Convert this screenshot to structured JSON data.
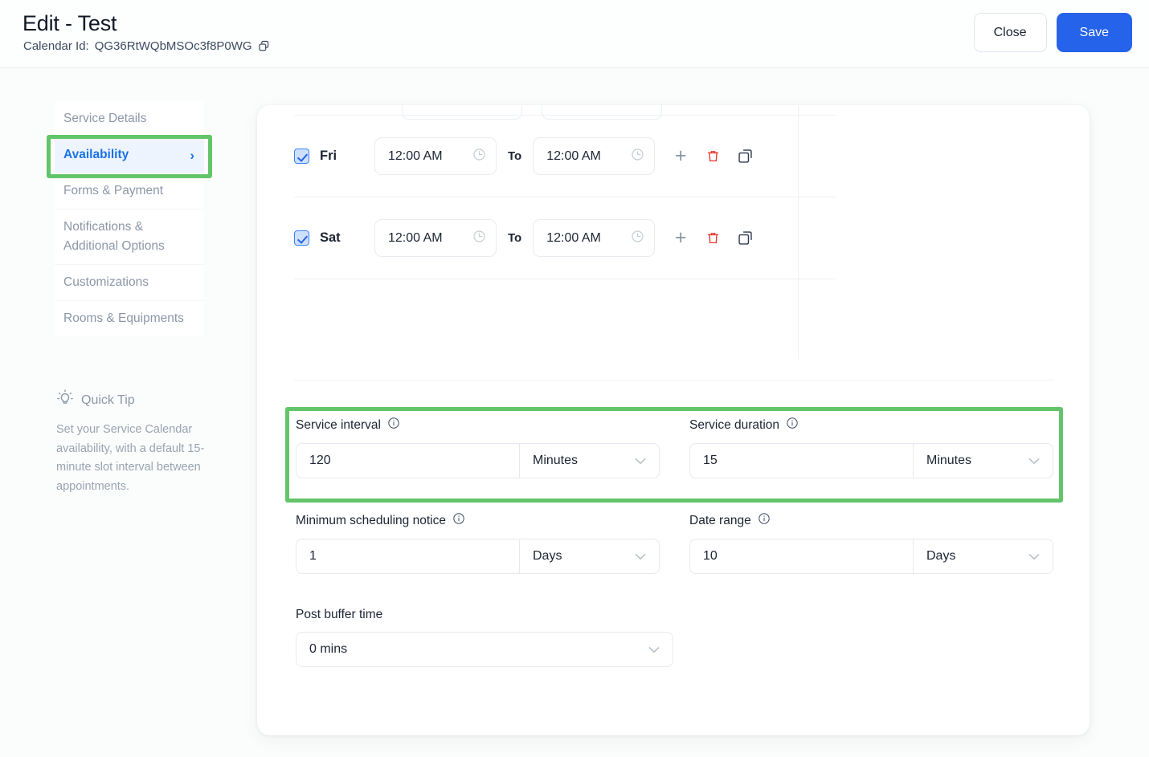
{
  "header": {
    "title": "Edit - Test",
    "calendar_id_label": "Calendar Id:",
    "calendar_id": "QG36RtWQbMSOc3f8P0WG",
    "copy_icon": "copy-icon",
    "close_label": "Close",
    "save_label": "Save",
    "save_color": "#2563eb"
  },
  "sidebar": {
    "items": [
      {
        "label": "Service Details",
        "active": false
      },
      {
        "label": "Availability",
        "active": true,
        "chevron": "›"
      },
      {
        "label": "Forms & Payment",
        "active": false
      },
      {
        "label": "Notifications & Additional Options",
        "active": false
      },
      {
        "label": "Customizations",
        "active": false
      },
      {
        "label": "Rooms & Equipments",
        "active": false
      }
    ],
    "highlight_color": "#63c56a",
    "active_color": "#1a73e8"
  },
  "quick_tip": {
    "icon": "lightbulb-icon",
    "title": "Quick Tip",
    "body": "Set your Service Calendar availability, with a default 15-minute slot interval between appointments."
  },
  "availability": {
    "to_label": "To",
    "days": [
      {
        "name": "Fri",
        "checked": true,
        "start": "12:00 AM",
        "end": "12:00 AM",
        "add_icon": "plus-icon",
        "delete_icon": "trash-icon",
        "duplicate_icon": "duplicate-icon"
      },
      {
        "name": "Sat",
        "checked": true,
        "start": "12:00 AM",
        "end": "12:00 AM",
        "add_icon": "plus-icon",
        "delete_icon": "trash-icon",
        "duplicate_icon": "duplicate-icon"
      }
    ],
    "clock_icon": "clock-icon",
    "delete_color": "#e8342a"
  },
  "settings": {
    "service_interval": {
      "label": "Service interval",
      "info_icon": "info-icon",
      "value": "120",
      "unit": "Minutes",
      "highlighted": true
    },
    "service_duration": {
      "label": "Service duration",
      "info_icon": "info-icon",
      "value": "15",
      "unit": "Minutes",
      "highlighted": true
    },
    "minimum_scheduling_notice": {
      "label": "Minimum scheduling notice",
      "info_icon": "info-icon",
      "value": "1",
      "unit": "Days"
    },
    "date_range": {
      "label": "Date range",
      "info_icon": "info-icon",
      "value": "10",
      "unit": "Days"
    },
    "post_buffer_time": {
      "label": "Post buffer time",
      "value": "0 mins"
    }
  }
}
